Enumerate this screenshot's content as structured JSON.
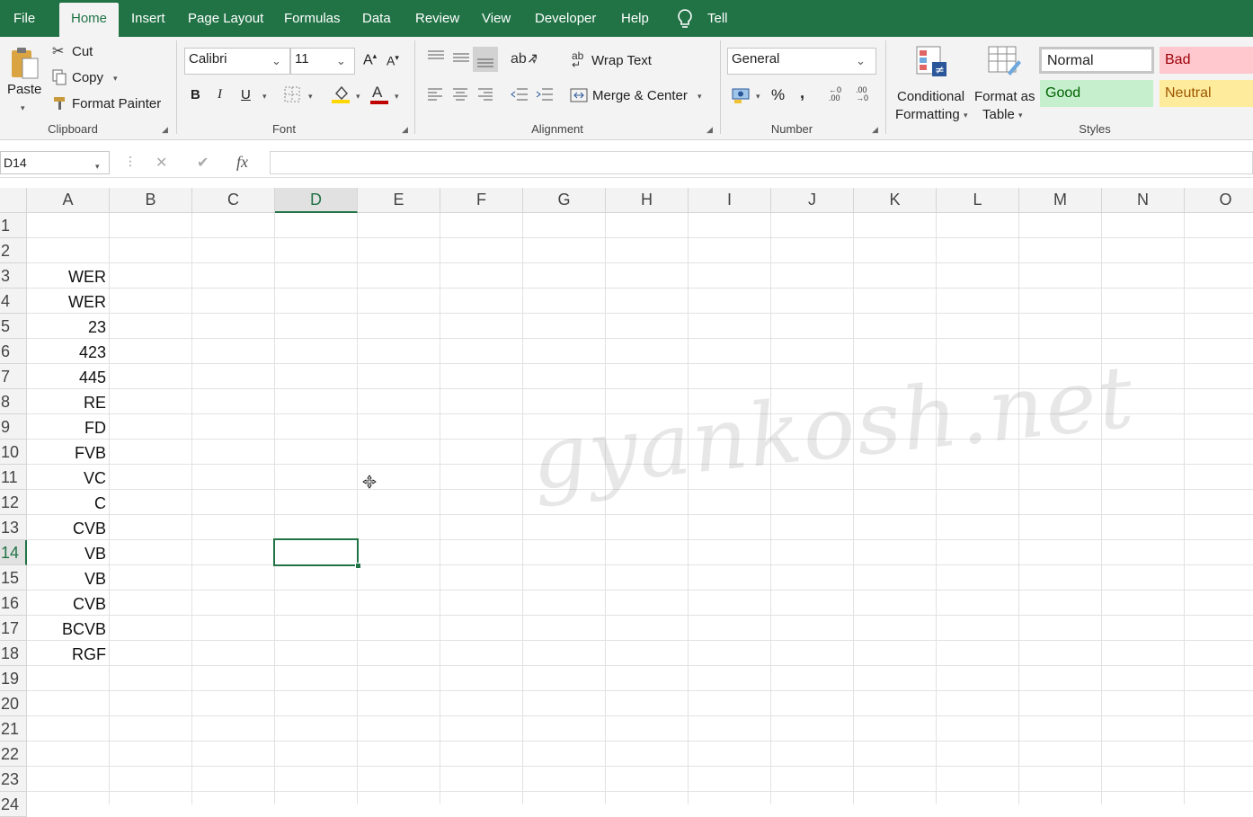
{
  "menu": {
    "tabs": [
      "File",
      "Home",
      "Insert",
      "Page Layout",
      "Formulas",
      "Data",
      "Review",
      "View",
      "Developer",
      "Help"
    ],
    "active_tab": "Home",
    "tell_me": "Tell me what you want to do"
  },
  "clipboard": {
    "paste": "Paste",
    "cut": "Cut",
    "copy": "Copy",
    "format_painter": "Format Painter",
    "label": "Clipboard"
  },
  "font": {
    "name": "Calibri",
    "size": "11",
    "label": "Font",
    "bold": "B",
    "italic": "I",
    "underline": "U",
    "grow": "A",
    "shrink": "A",
    "font_color_glyph": "A",
    "font_color": "#c00000",
    "highlight_color": "#ffd700"
  },
  "alignment": {
    "wrap_text": "Wrap Text",
    "merge_center": "Merge & Center",
    "label": "Alignment"
  },
  "number": {
    "format": "General",
    "percent": "%",
    "comma": ",",
    "label": "Number"
  },
  "styles_group": {
    "conditional": [
      "Conditional",
      "Formatting"
    ],
    "format_table": [
      "Format as",
      "Table"
    ],
    "label": "Styles",
    "normal": "Normal",
    "bad": "Bad",
    "good": "Good",
    "neutral": "Neutral",
    "colors": {
      "bad_bg": "#ffc7ce",
      "bad_fg": "#9c0006",
      "good_bg": "#c6efce",
      "good_fg": "#006100",
      "neutral_bg": "#ffeb9c",
      "neutral_fg": "#9c5700"
    }
  },
  "formula_bar": {
    "name_box": "D14",
    "cancel": "✕",
    "enter": "✔",
    "fx": "fx",
    "formula": ""
  },
  "columns": [
    "A",
    "B",
    "C",
    "D",
    "E",
    "F",
    "G",
    "H",
    "I",
    "J",
    "K",
    "L",
    "M",
    "N",
    "O"
  ],
  "selected_column": "D",
  "rows": [
    "1",
    "2",
    "3",
    "4",
    "5",
    "6",
    "7",
    "8",
    "9",
    "10",
    "11",
    "12",
    "13",
    "14",
    "15",
    "16",
    "17",
    "18",
    "19",
    "20",
    "21",
    "22",
    "23",
    "24"
  ],
  "selected_row": "14",
  "column_a": [
    "",
    "",
    "WER",
    "WER",
    "23",
    "423",
    "445",
    "RE",
    "FD",
    "FVB",
    "VC",
    "C",
    "CVB",
    "VB",
    "VB",
    "CVB",
    "BCVB",
    "RGF"
  ],
  "watermark": "gyankosh.net",
  "accent": "#217346"
}
